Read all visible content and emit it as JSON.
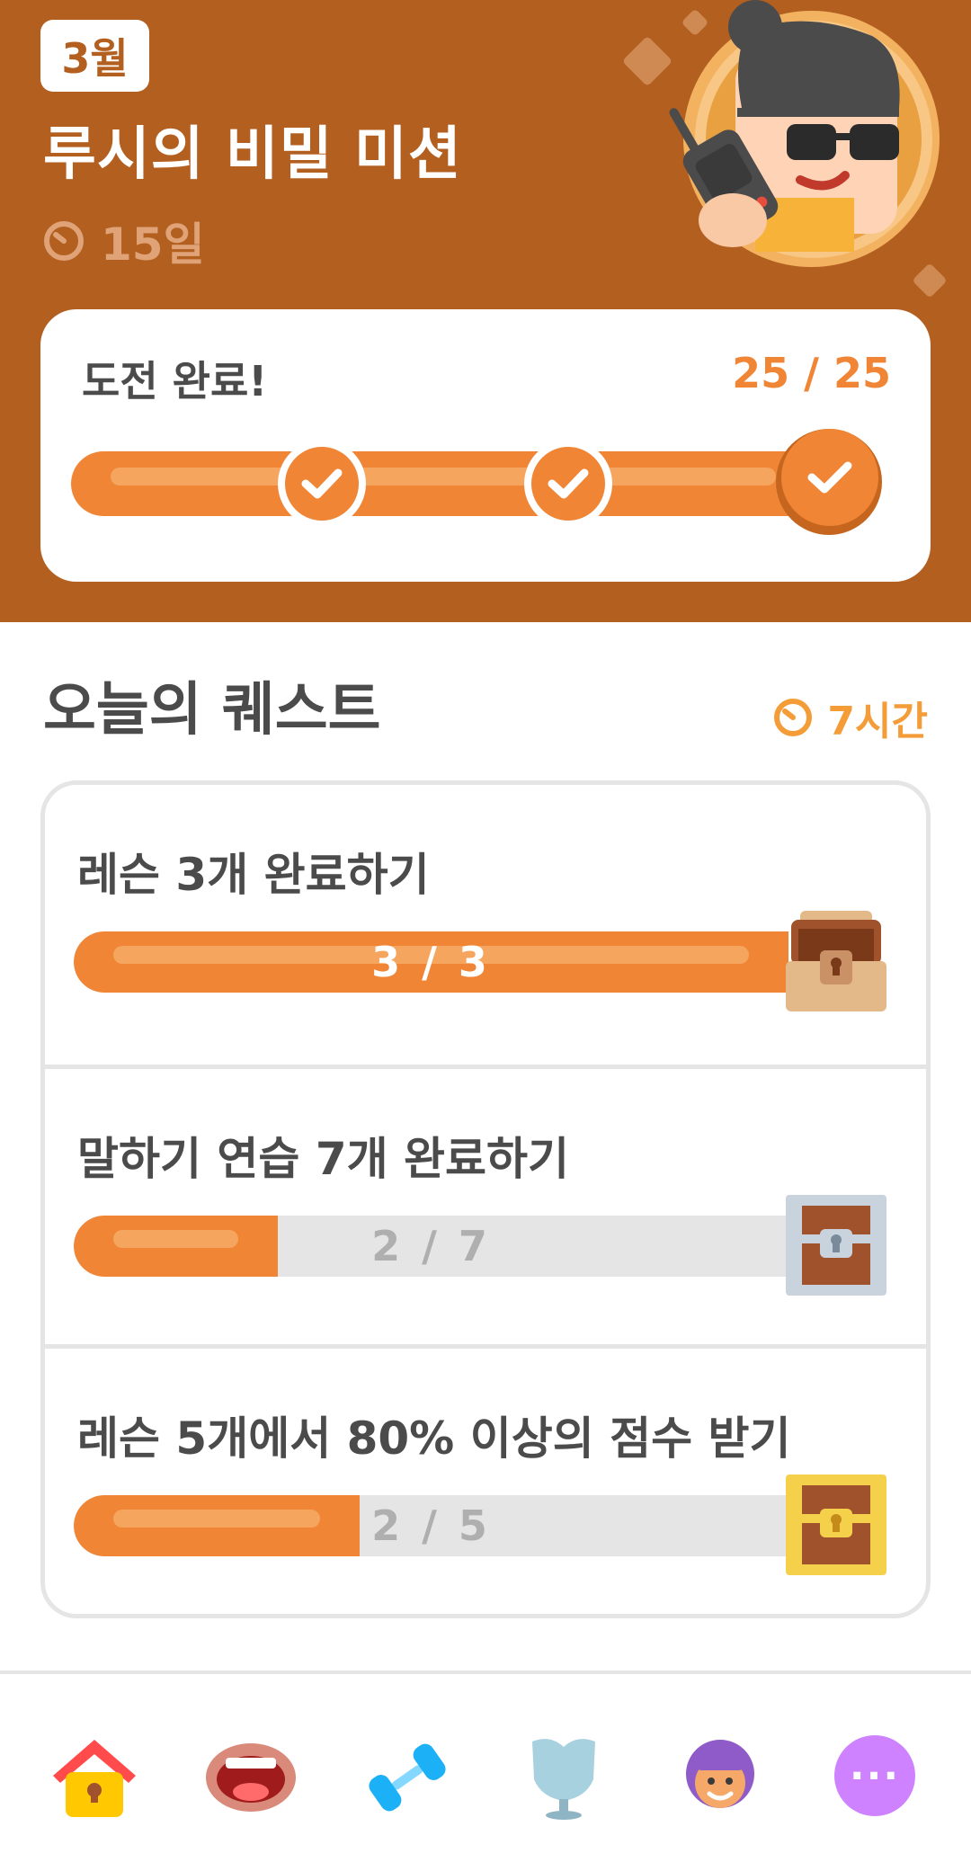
{
  "header": {
    "month_badge": "3월",
    "title": "루시의 비밀 미션",
    "days_left": "15일",
    "challenge": {
      "label": "도전 완료!",
      "progress_text": "25 / 25",
      "progress": 1.0,
      "milestones": 3
    }
  },
  "quests": {
    "title": "오늘의 퀘스트",
    "timer": "7시간",
    "items": [
      {
        "label": "레슨 3개 완료하기",
        "progress_text": "3 / 3",
        "progress": 1.0,
        "chest": "brown-chest-open"
      },
      {
        "label": "말하기 연습 7개 완료하기",
        "progress_text": "2 / 7",
        "progress": 0.2857,
        "chest": "silver-chest"
      },
      {
        "label": "레슨 5개에서 80% 이상의 점수 받기",
        "progress_text": "2 / 5",
        "progress": 0.4,
        "chest": "gold-chest"
      }
    ]
  },
  "nav": {
    "items": [
      "home-icon",
      "speaking-mouth-icon",
      "dumbbell-icon",
      "shield-icon",
      "profile-avatar-icon",
      "more-icon"
    ],
    "more_label": "···"
  },
  "colors": {
    "header_bg": "#b35f20",
    "accent_orange": "#ef8535",
    "track_gray": "#e5e5e5",
    "timer_orange": "#f49d38",
    "more_purple": "#ce82ff"
  }
}
